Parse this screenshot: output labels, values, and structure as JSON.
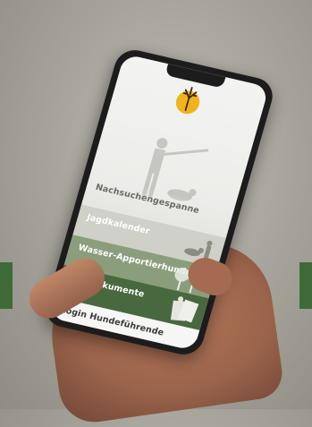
{
  "app": {
    "menu_items": [
      {
        "label": "Nachsuchengespanne"
      },
      {
        "label": "Jagdkalender"
      },
      {
        "label": "Wasser-Apportierhunde"
      },
      {
        "label": "Jagddokumente"
      },
      {
        "label": "Login Hundeführende"
      }
    ]
  },
  "icons": {
    "logo": "deer-antler-logo-icon",
    "hunter": "hunter-silhouette-icon",
    "dog": "dog-silhouette-icon",
    "trees": "trees-icon",
    "documents": "documents-icon"
  },
  "colors": {
    "logo": "#f2b21b",
    "menu_dark_green": "#48683f",
    "menu_mid_green": "#8a9e7c",
    "menu_light": "#cfd0c7",
    "side_accent": "#3f6a37"
  }
}
